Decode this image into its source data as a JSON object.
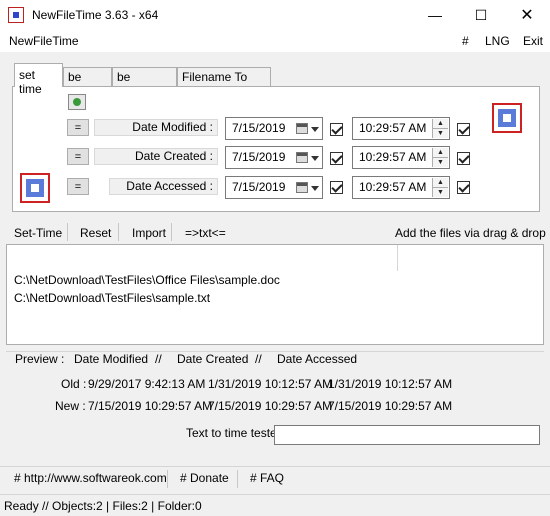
{
  "window": {
    "title": "NewFileTime 3.63 - x64"
  },
  "menu": {
    "app_name": "NewFileTime",
    "hash": "#",
    "lng": "LNG",
    "exit": "Exit"
  },
  "tabs": [
    "set time",
    "be older",
    "be younger",
    "Filename To Time"
  ],
  "rows": [
    {
      "eq": "=",
      "label": "Date Modified :",
      "date": "7/15/2019",
      "time": "10:29:57 AM"
    },
    {
      "eq": "=",
      "label": "Date Created :",
      "date": "7/15/2019",
      "time": "10:29:57 AM"
    },
    {
      "eq": "=",
      "label": "Date Accessed :",
      "date": "7/15/2019",
      "time": "10:29:57 AM"
    }
  ],
  "toolbar": {
    "set_time": "Set-Time",
    "reset": "Reset",
    "import": "Import",
    "txt": "=>txt<=",
    "drag_drop": "Add the files via drag & drop"
  },
  "files": [
    "C:\\NetDownload\\TestFiles\\Office Files\\sample.doc",
    "C:\\NetDownload\\TestFiles\\sample.txt"
  ],
  "preview": {
    "label": "Preview  :",
    "col1": "Date Modified",
    "sep1": "//",
    "col2": "Date Created",
    "sep2": "//",
    "col3": "Date Accessed",
    "old_label": "Old :",
    "old_values": [
      "9/29/2017 9:42:13 AM",
      "1/31/2019 10:12:57 AM",
      "1/31/2019 10:12:57 AM"
    ],
    "new_label": "New :",
    "new_values": [
      "7/15/2019 10:29:57 AM",
      "7/15/2019 10:29:57 AM",
      "7/15/2019 10:29:57 AM"
    ]
  },
  "tester": {
    "label": "Text to time tester",
    "value": ""
  },
  "links": [
    "# http://www.softwareok.com",
    "# Donate",
    "# FAQ"
  ],
  "status": "Ready // Objects:2 | Files:2  | Folder:0"
}
